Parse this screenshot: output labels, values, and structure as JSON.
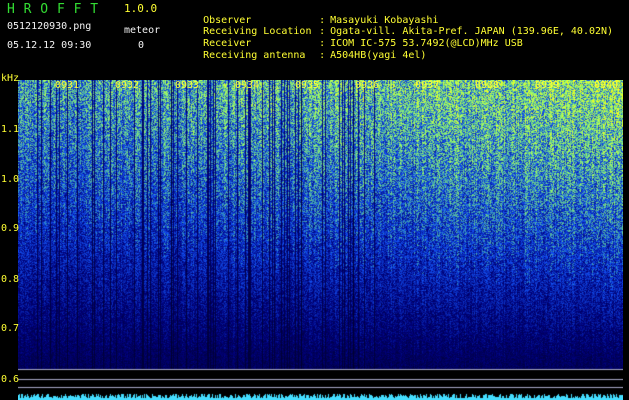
{
  "app": {
    "title": "H R O F F T",
    "version": "1.0.0"
  },
  "file": {
    "name": "0512120930.png",
    "datetime": "05.12.12 09:30"
  },
  "meteor": {
    "label": "meteor",
    "count": "0"
  },
  "info": [
    {
      "label": "Observer",
      "value": "Masayuki Kobayashi"
    },
    {
      "label": "Receiving Location",
      "value": "Ogata-vill. Akita-Pref. JAPAN (139.96E, 40.02N)"
    },
    {
      "label": "Receiver",
      "value": "ICOM IC-575 53.7492(@LCD)MHz USB"
    },
    {
      "label": "Receiving antenna",
      "value": "A504HB(yagi 4el)"
    }
  ],
  "axis": {
    "unit": "kHz",
    "freq_labels": [
      "1.1",
      "1.0",
      "0.9",
      "0.8",
      "0.7",
      "0.6"
    ],
    "time_labels": [
      "0931",
      "0932",
      "0933",
      "0934",
      "0935",
      "0936",
      "0937",
      "0938",
      "0939",
      "0940"
    ]
  },
  "colors": {
    "green": "#33dd33",
    "yellow": "#ffff33",
    "white": "#f4f4f4",
    "background": "#000000",
    "low": "#00145a",
    "mid": "#1d5cff",
    "high": "#7cff9a"
  }
}
